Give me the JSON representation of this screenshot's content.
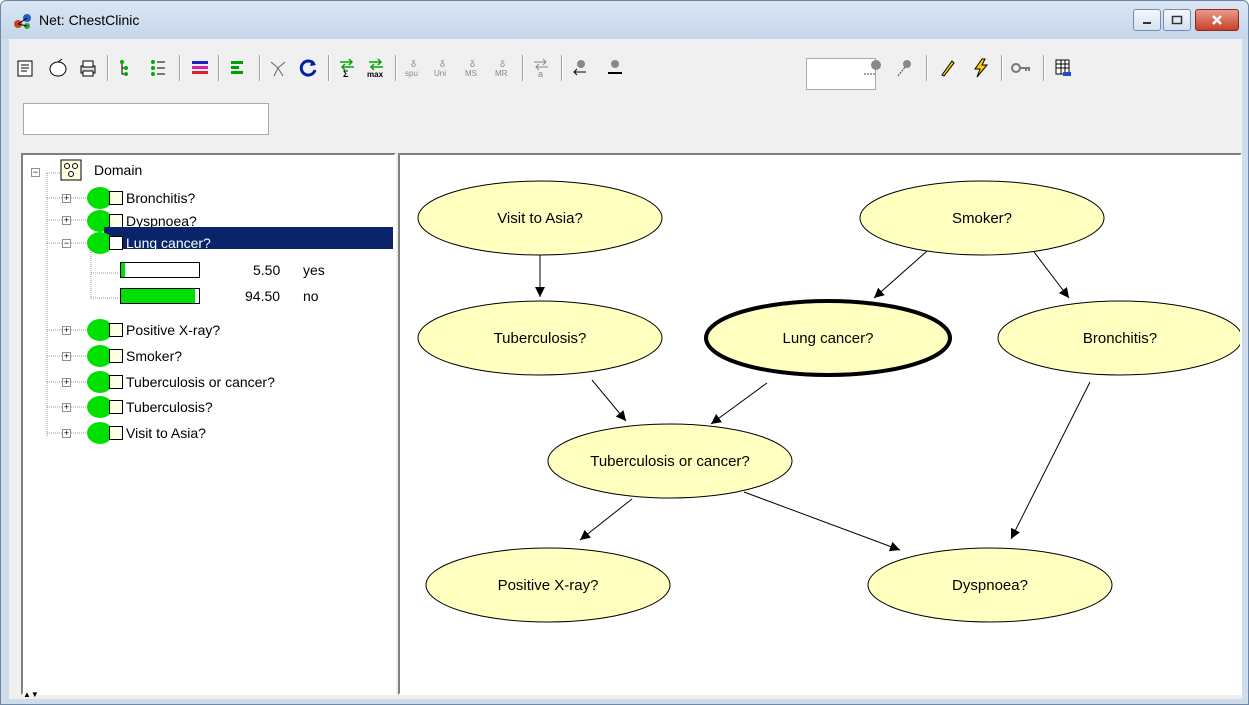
{
  "window": {
    "title": "Net: ChestClinic"
  },
  "toolbar": {
    "input_value": "",
    "search_value": ""
  },
  "tree": {
    "root_label": "Domain",
    "items": [
      {
        "label": "Bronchitis?"
      },
      {
        "label": "Dyspnoea?"
      },
      {
        "label": "Lung cancer?",
        "expanded": true,
        "selected": true,
        "states": [
          {
            "value": "5.50",
            "name": "yes",
            "fraction": 0.055
          },
          {
            "value": "94.50",
            "name": "no",
            "fraction": 0.945
          }
        ]
      },
      {
        "label": "Positive X-ray?"
      },
      {
        "label": "Smoker?"
      },
      {
        "label": "Tuberculosis or cancer?"
      },
      {
        "label": "Tuberculosis?"
      },
      {
        "label": "Visit to Asia?"
      }
    ]
  },
  "network": {
    "nodes": {
      "visit_to_asia": "Visit to Asia?",
      "smoker": "Smoker?",
      "tuberculosis": "Tuberculosis?",
      "lung_cancer": "Lung cancer?",
      "bronchitis": "Bronchitis?",
      "tub_or_cancer": "Tuberculosis or cancer?",
      "positive_xray": "Positive X-ray?",
      "dyspnoea": "Dyspnoea?"
    },
    "node_fill": "#ffffc0",
    "selected_node": "lung_cancer"
  },
  "colors": {
    "selection": "#0a246a",
    "state_bar": "#00e000",
    "node_blob": "#00e000"
  }
}
